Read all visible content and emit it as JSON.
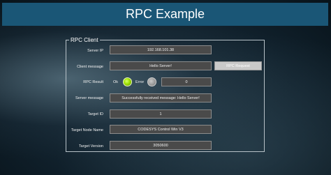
{
  "header": {
    "title": "RPC Example"
  },
  "panel": {
    "legend": "RPC Client"
  },
  "server_ip": {
    "label": "Server IP",
    "value": "192.168.101.38"
  },
  "client_message": {
    "label": "Client message",
    "value": "Hello Server!"
  },
  "rpc_request_button": {
    "label": "RPC Request"
  },
  "rpc_result": {
    "label": "RPC Result",
    "ok_label": "Ok",
    "error_label": "Error",
    "value": "0",
    "ok_active": true,
    "error_active": false
  },
  "server_message": {
    "label": "Server message",
    "value": "Successfully received message: Hello Server!"
  },
  "target_id": {
    "label": "Target ID",
    "value": "1"
  },
  "target_node_name": {
    "label": "Target Node Name",
    "value": "CODESYS Control Win V3"
  },
  "target_version": {
    "label": "Target Version",
    "value": "3050600"
  },
  "colors": {
    "title_bar": "#1a5676",
    "lamp_ok": "#9ee000",
    "lamp_error": "#9a9a9a",
    "field_bg": "#4a4a4a"
  }
}
